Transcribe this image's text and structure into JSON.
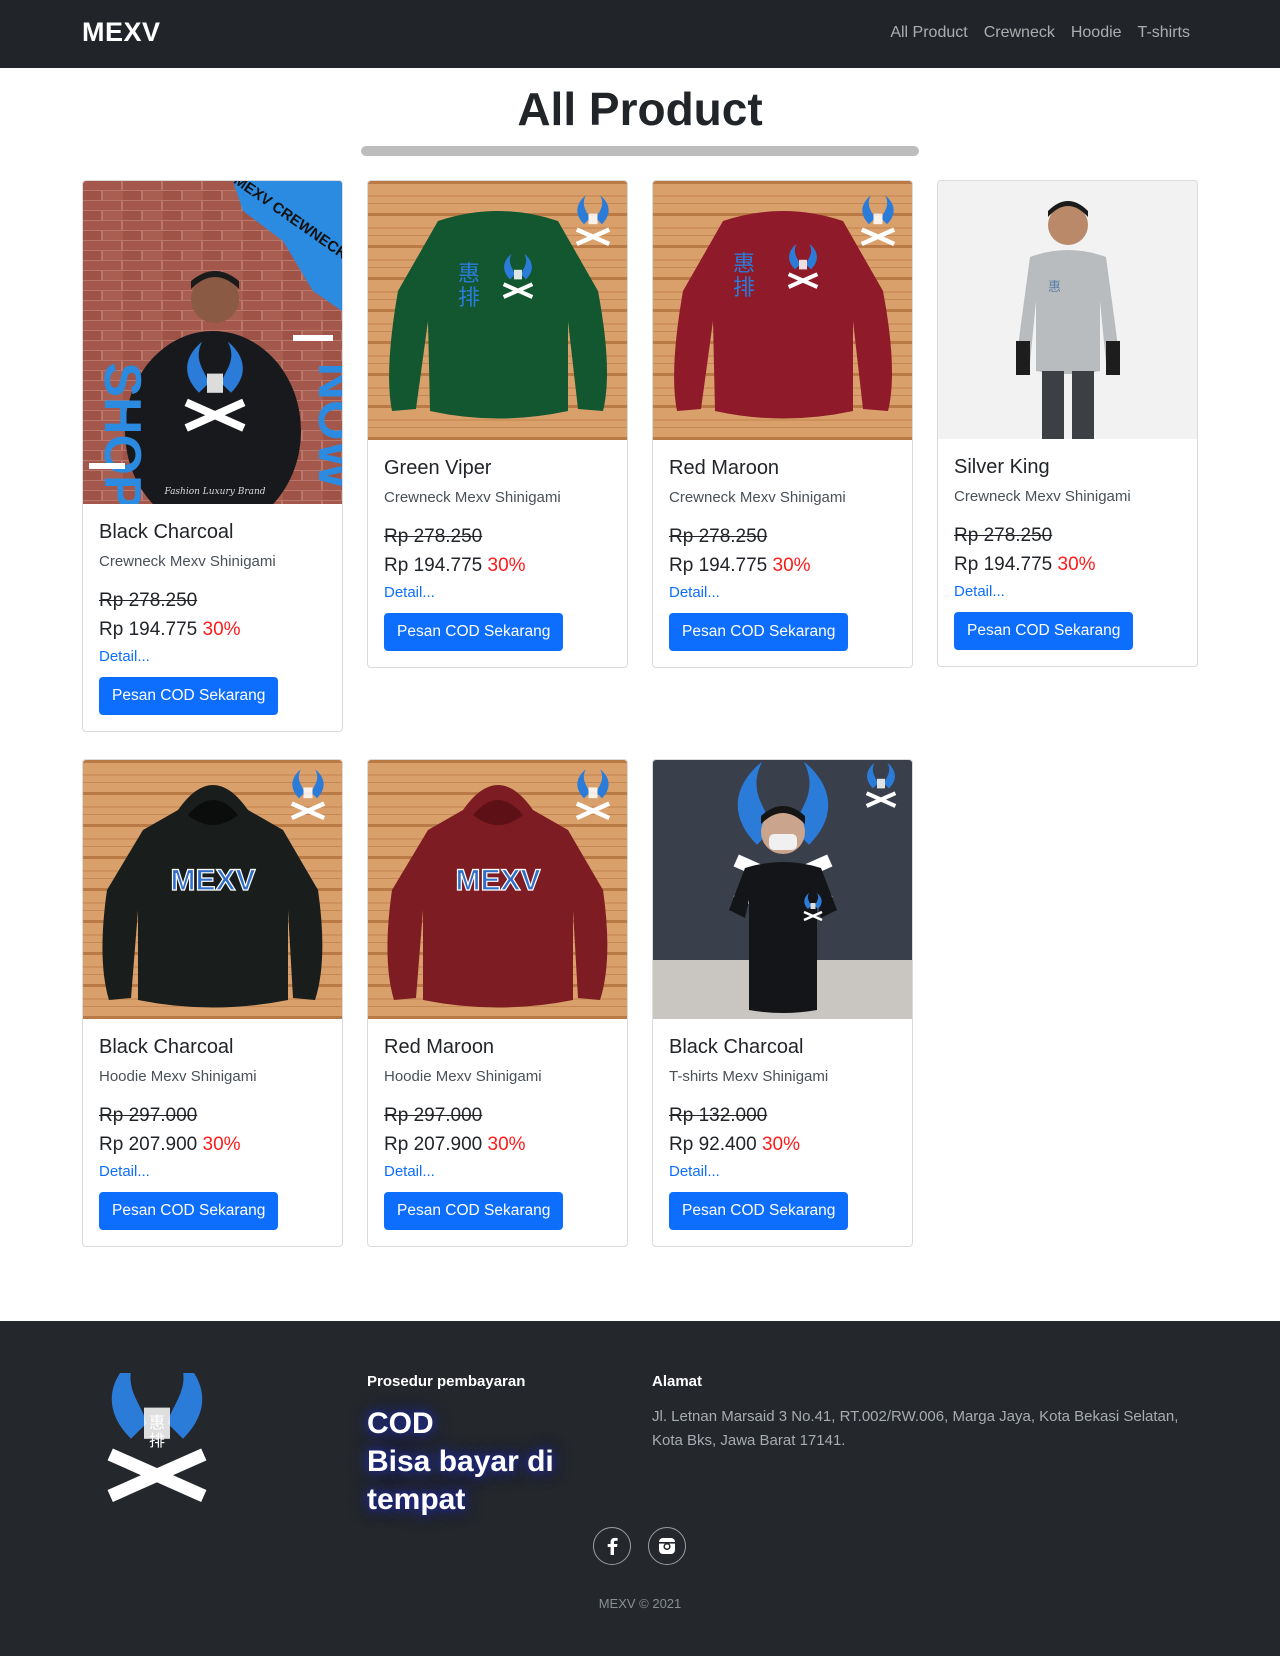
{
  "navbar": {
    "brand": "MEXV",
    "links": [
      "All Product",
      "Crewneck",
      "Hoodie",
      "T-shirts"
    ]
  },
  "page": {
    "title": "All Product"
  },
  "products": [
    {
      "name": "Black Charcoal",
      "category": "Crewneck Mexv Shinigami",
      "old_price": "Rp 278.250",
      "price": "Rp 194.775",
      "discount": "30%",
      "detail": "Detail...",
      "button": "Pesan COD Sekarang"
    },
    {
      "name": "Green Viper",
      "category": "Crewneck Mexv Shinigami",
      "old_price": "Rp 278.250",
      "price": "Rp 194.775",
      "discount": "30%",
      "detail": "Detail...",
      "button": "Pesan COD Sekarang"
    },
    {
      "name": "Red Maroon",
      "category": "Crewneck Mexv Shinigami",
      "old_price": "Rp 278.250",
      "price": "Rp 194.775",
      "discount": "30%",
      "detail": "Detail...",
      "button": "Pesan COD Sekarang"
    },
    {
      "name": "Silver King",
      "category": "Crewneck Mexv Shinigami",
      "old_price": "Rp 278.250",
      "price": "Rp 194.775",
      "discount": "30%",
      "detail": "Detail...",
      "button": "Pesan COD Sekarang"
    },
    {
      "name": "Black Charcoal",
      "category": "Hoodie Mexv Shinigami",
      "old_price": "Rp 297.000",
      "price": "Rp 207.900",
      "discount": "30%",
      "detail": "Detail...",
      "button": "Pesan COD Sekarang"
    },
    {
      "name": "Red Maroon",
      "category": "Hoodie Mexv Shinigami",
      "old_price": "Rp 297.000",
      "price": "Rp 207.900",
      "discount": "30%",
      "detail": "Detail...",
      "button": "Pesan COD Sekarang"
    },
    {
      "name": "Black Charcoal",
      "category": "T-shirts Mexv Shinigami",
      "old_price": "Rp 132.000",
      "price": "Rp 92.400",
      "discount": "30%",
      "detail": "Detail...",
      "button": "Pesan COD Sekarang"
    }
  ],
  "images": {
    "promo_banner": {
      "brand_text": "MEXV CREWNECK",
      "left_text": "SHOP",
      "right_text": "NOW",
      "tagline": "Fashion Luxury Brand"
    },
    "hoodie_print": "MEXV"
  },
  "footer": {
    "payment_heading": "Prosedur pembayaran",
    "payment_text_1": "COD",
    "payment_text_2": "Bisa bayar di tempat",
    "address_heading": "Alamat",
    "address_text": "Jl. Letnan Marsaid 3 No.41, RT.002/RW.006, Marga Jaya, Kota Bekasi Selatan, Kota Bks, Jawa Barat 17141.",
    "social": [
      "facebook-icon",
      "instagram-icon"
    ],
    "copyright": "MEXV © 2021"
  },
  "colors": {
    "navbar_bg": "#212529",
    "footer_bg": "#24272b",
    "primary": "#0d6efd",
    "discount": "#ff1a1a"
  }
}
